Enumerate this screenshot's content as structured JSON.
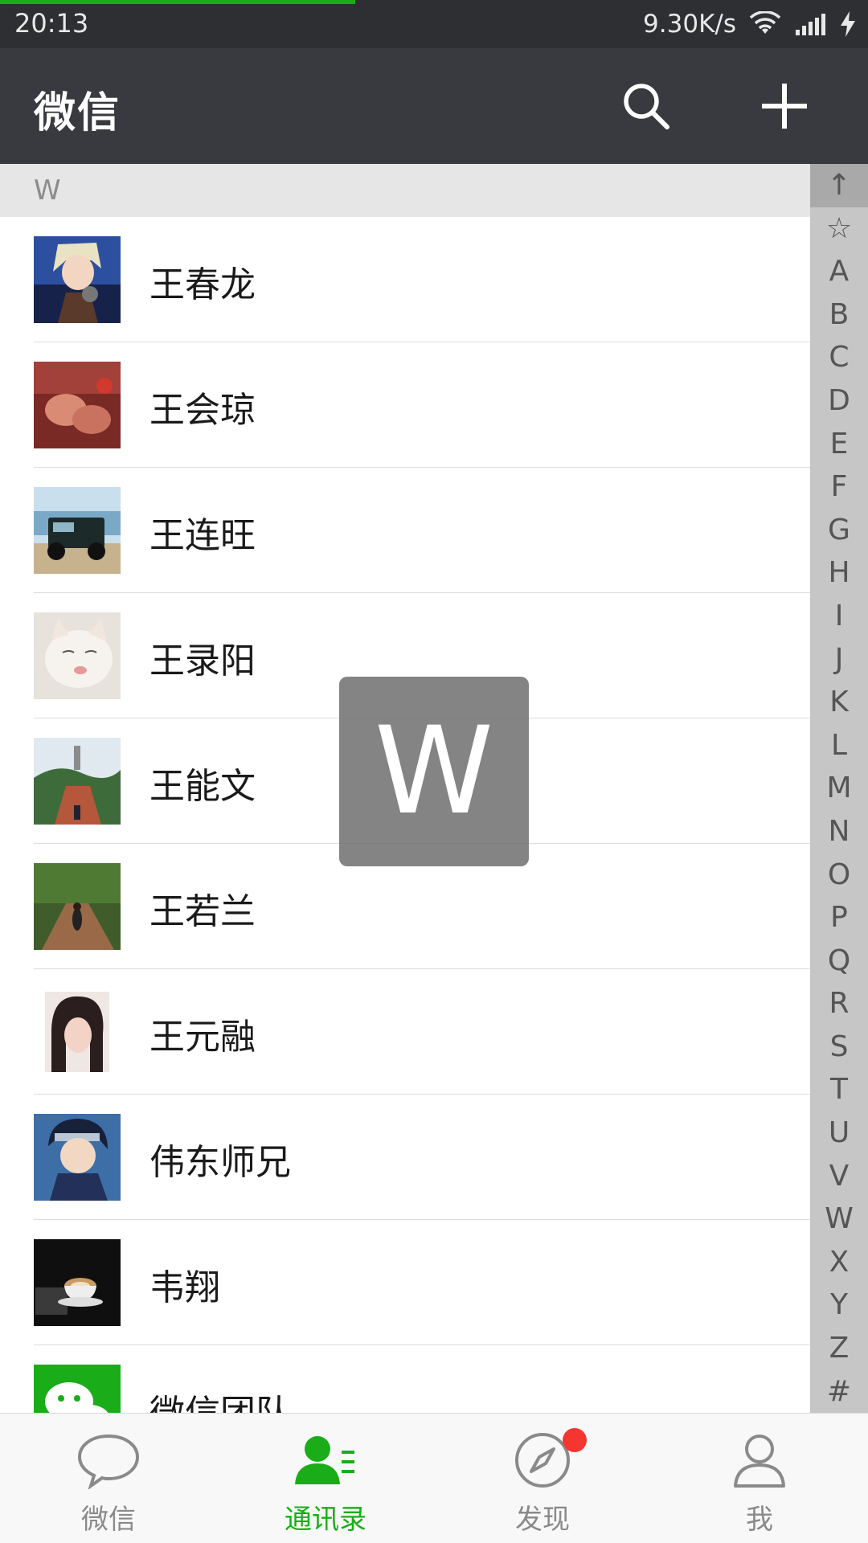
{
  "status_bar": {
    "time": "20:13",
    "net_speed": "9.30K/s",
    "icons": [
      "wifi-icon",
      "signal-icon",
      "charging-icon"
    ]
  },
  "title_bar": {
    "title": "微信",
    "icons": [
      "search-icon",
      "plus-icon"
    ]
  },
  "section_header": "W",
  "contacts": [
    {
      "name": "王春龙",
      "avatar": "avatar-anime-singer"
    },
    {
      "name": "王会琼",
      "avatar": "avatar-hands"
    },
    {
      "name": "王连旺",
      "avatar": "avatar-jeep"
    },
    {
      "name": "王录阳",
      "avatar": "avatar-cat"
    },
    {
      "name": "王能文",
      "avatar": "avatar-landscape"
    },
    {
      "name": "王若兰",
      "avatar": "avatar-forest-path"
    },
    {
      "name": "王元融",
      "avatar": "avatar-portrait"
    },
    {
      "name": "伟东师兄",
      "avatar": "avatar-anime-ninja"
    },
    {
      "name": "韦翔",
      "avatar": "avatar-coffee"
    },
    {
      "name": "微信团队",
      "avatar": "avatar-wechat-logo"
    }
  ],
  "index_bar": [
    "↑",
    "☆",
    "A",
    "B",
    "C",
    "D",
    "E",
    "F",
    "G",
    "H",
    "I",
    "J",
    "K",
    "L",
    "M",
    "N",
    "O",
    "P",
    "Q",
    "R",
    "S",
    "T",
    "U",
    "V",
    "W",
    "X",
    "Y",
    "Z",
    "#"
  ],
  "letter_overlay": "W",
  "tabs": [
    {
      "label": "微信",
      "icon": "chat-bubble-icon",
      "active": false
    },
    {
      "label": "通讯录",
      "icon": "contacts-icon",
      "active": true
    },
    {
      "label": "发现",
      "icon": "compass-icon",
      "active": false,
      "badge": true
    },
    {
      "label": "我",
      "icon": "person-icon",
      "active": false
    }
  ],
  "colors": {
    "accent": "#1aad19",
    "title_bar_bg": "#393a3f",
    "status_bar_bg": "#2e2f33",
    "badge_red": "#f43530"
  }
}
